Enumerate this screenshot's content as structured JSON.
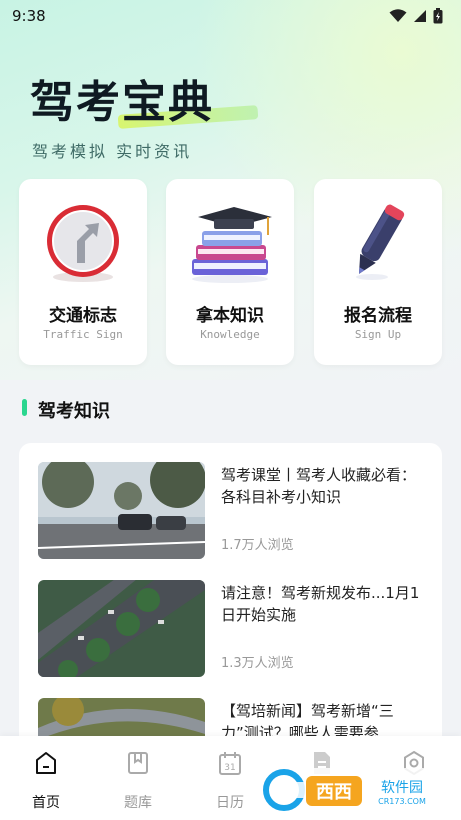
{
  "status_bar": {
    "time": "9:38"
  },
  "hero": {
    "title": "驾考宝典",
    "subtitle": "驾考模拟 实时资讯"
  },
  "feature_cards": [
    {
      "title": "交通标志",
      "subtitle": "Traffic Sign",
      "icon": "traffic-sign-icon"
    },
    {
      "title": "拿本知识",
      "subtitle": "Knowledge",
      "icon": "books-icon"
    },
    {
      "title": "报名流程",
      "subtitle": "Sign Up",
      "icon": "pen-icon"
    }
  ],
  "section": {
    "title": "驾考知识"
  },
  "news": [
    {
      "title": "驾考课堂丨驾考人收藏必看：各科目补考小知识",
      "views": "1.7万人浏览"
    },
    {
      "title": "请注意！驾考新规发布...1月1日开始实施",
      "views": "1.3万人浏览"
    },
    {
      "title": "【驾培新闻】驾考新增“三力”测试？哪些人需要参...",
      "views": ""
    }
  ],
  "tabs": [
    {
      "label": "首页",
      "icon": "home-icon",
      "active": true
    },
    {
      "label": "题库",
      "icon": "bookmark-icon",
      "active": false
    },
    {
      "label": "日历",
      "icon": "calendar-icon",
      "active": false
    },
    {
      "label": "",
      "icon": "document-icon",
      "active": false
    },
    {
      "label": "",
      "icon": "settings-icon",
      "active": false
    }
  ],
  "calendar_icon_text": "31",
  "watermark": {
    "brand": "西西软件园",
    "url": "CR173.COM"
  },
  "colors": {
    "accent": "#2ad68f",
    "background": "#f1f3f6"
  }
}
